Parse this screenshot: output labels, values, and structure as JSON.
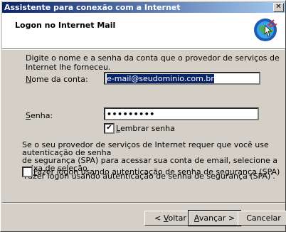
{
  "window": {
    "title": "Assistente para conexão com a Internet"
  },
  "header": {
    "title": "Logon no Internet Mail"
  },
  "intro": "Digite o nome e a senha da conta que o provedor de serviços de Internet lhe forneceu.",
  "account": {
    "label_u": "N",
    "label_rest": "ome da conta:",
    "value": "e-mail@seudominio.com.br"
  },
  "password": {
    "label_u": "S",
    "label_rest": "enha:",
    "value": "•••••••••"
  },
  "remember": {
    "label_u": "L",
    "label_rest": "embrar senha",
    "checked": true
  },
  "spa_info": [
    "Se o seu provedor de serviços de Internet requer que você use autenticação de senha",
    "de segurança (SPA) para acessar sua conta de email, selecione a caixa de seleção",
    "'Fazer logon usando autenticação de senha de segurança (SPA)'."
  ],
  "spa_checkbox": {
    "label_u": "F",
    "label_rest": "azer logon usando autenticação de senha de segurança (SPA)",
    "checked": false
  },
  "buttons": {
    "back_pre": "< ",
    "back_u": "V",
    "back_rest": "oltar",
    "next_u": "A",
    "next_rest": "vançar >",
    "cancel": "Cancelar"
  }
}
